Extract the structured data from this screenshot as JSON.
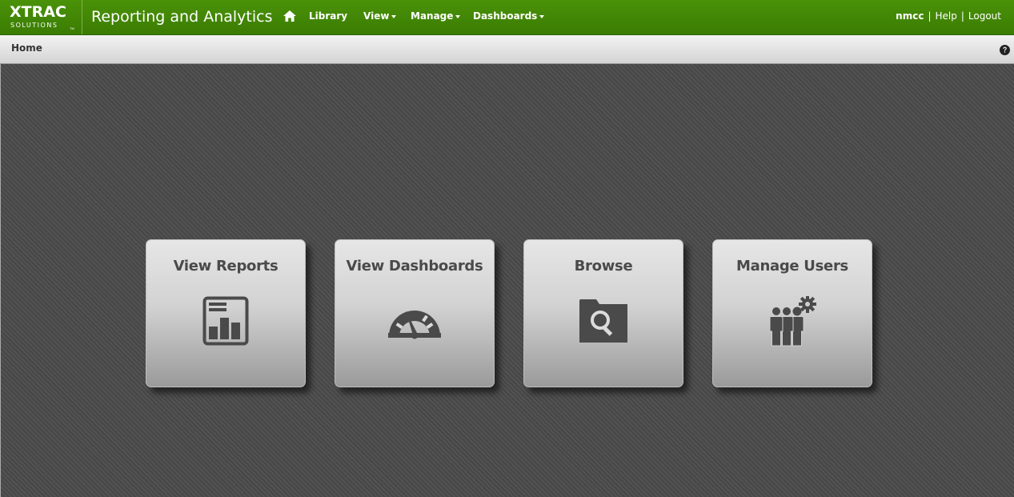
{
  "logo": {
    "main": "XTRAC",
    "sub": "SOLUTIONS",
    "tm": "TM"
  },
  "app": {
    "title": "Reporting and Analytics"
  },
  "nav": {
    "home_icon": "home-icon",
    "items": [
      {
        "label": "Library",
        "dropdown": false
      },
      {
        "label": "View",
        "dropdown": true
      },
      {
        "label": "Manage",
        "dropdown": true
      },
      {
        "label": "Dashboards",
        "dropdown": true
      }
    ]
  },
  "user": {
    "name": "nmcc",
    "separator": "|",
    "help": "Help",
    "logout": "Logout"
  },
  "breadcrumb": {
    "current": "Home",
    "help_icon": "question-circle-icon"
  },
  "tiles": [
    {
      "title": "View Reports",
      "icon": "report-chart-icon"
    },
    {
      "title": "View Dashboards",
      "icon": "gauge-icon"
    },
    {
      "title": "Browse",
      "icon": "folder-search-icon"
    },
    {
      "title": "Manage Users",
      "icon": "users-gear-icon"
    }
  ],
  "colors": {
    "topbar": "#3f8405",
    "tile_icon": "#4a4a4a",
    "background": "#4c4c4c"
  }
}
